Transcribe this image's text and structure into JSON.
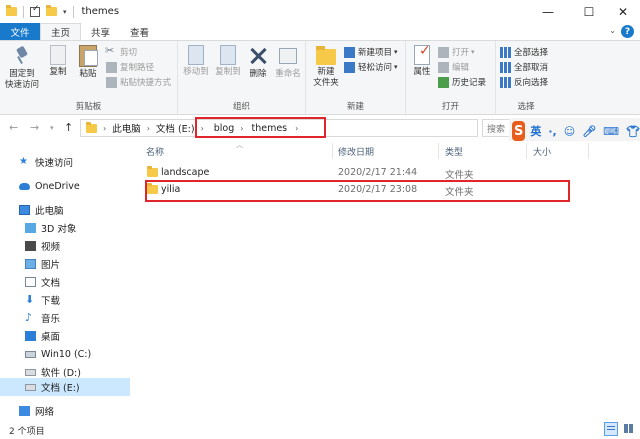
{
  "window": {
    "title": "themes",
    "minimize": "—",
    "maximize": "☐",
    "close": "✕"
  },
  "ribbon_tabs": [
    "文件",
    "主页",
    "共享",
    "查看"
  ],
  "ribbon": {
    "clipboard": {
      "label": "剪贴板",
      "pin": "固定到\n快速访问",
      "copy": "复制",
      "paste": "粘贴",
      "cut": "剪切",
      "copy_path": "复制路径",
      "paste_shortcut": "粘贴快捷方式"
    },
    "organize": {
      "label": "组织",
      "move_to": "移动到",
      "copy_to": "复制到",
      "delete": "删除",
      "rename": "重命名"
    },
    "new": {
      "label": "新建",
      "new_folder": "新建\n文件夹",
      "new_item": "新建项目",
      "easy_access": "轻松访问"
    },
    "open": {
      "label": "打开",
      "properties": "属性",
      "open": "打开",
      "edit": "编辑",
      "history": "历史记录"
    },
    "select": {
      "label": "选择",
      "select_all": "全部选择",
      "select_none": "全部取消",
      "invert": "反向选择"
    }
  },
  "address": {
    "crumbs": [
      "此电脑",
      "文档 (E:)",
      "blog",
      "themes"
    ],
    "search_placeholder": "搜索"
  },
  "ime": {
    "logo": "S",
    "lang": "英"
  },
  "nav_pane": [
    {
      "label": "快速访问",
      "icon": "star-icon"
    },
    {
      "label": "OneDrive",
      "icon": "cloud-icon"
    },
    {
      "label": "此电脑",
      "icon": "computer-icon"
    },
    {
      "label": "3D 对象",
      "icon": "3d-objects-icon"
    },
    {
      "label": "视频",
      "icon": "video-icon"
    },
    {
      "label": "图片",
      "icon": "pictures-icon"
    },
    {
      "label": "文档",
      "icon": "documents-icon"
    },
    {
      "label": "下载",
      "icon": "download-icon"
    },
    {
      "label": "音乐",
      "icon": "music-icon"
    },
    {
      "label": "桌面",
      "icon": "desktop-icon"
    },
    {
      "label": "Win10 (C:)",
      "icon": "drive-icon"
    },
    {
      "label": "软件 (D:)",
      "icon": "drive-icon"
    },
    {
      "label": "文档 (E:)",
      "icon": "drive-icon"
    },
    {
      "label": "网络",
      "icon": "network-icon"
    }
  ],
  "columns": [
    "名称",
    "修改日期",
    "类型",
    "大小"
  ],
  "files": [
    {
      "name": "landscape",
      "modified": "2020/2/17 21:44",
      "type": "文件夹",
      "size": ""
    },
    {
      "name": "yilia",
      "modified": "2020/2/17 23:08",
      "type": "文件夹",
      "size": ""
    }
  ],
  "status": {
    "count": "2 个项目"
  },
  "colors": {
    "accent": "#1979ca",
    "highlight": "#e0252b",
    "selection": "#cce8ff",
    "folder": "#f6c949"
  }
}
